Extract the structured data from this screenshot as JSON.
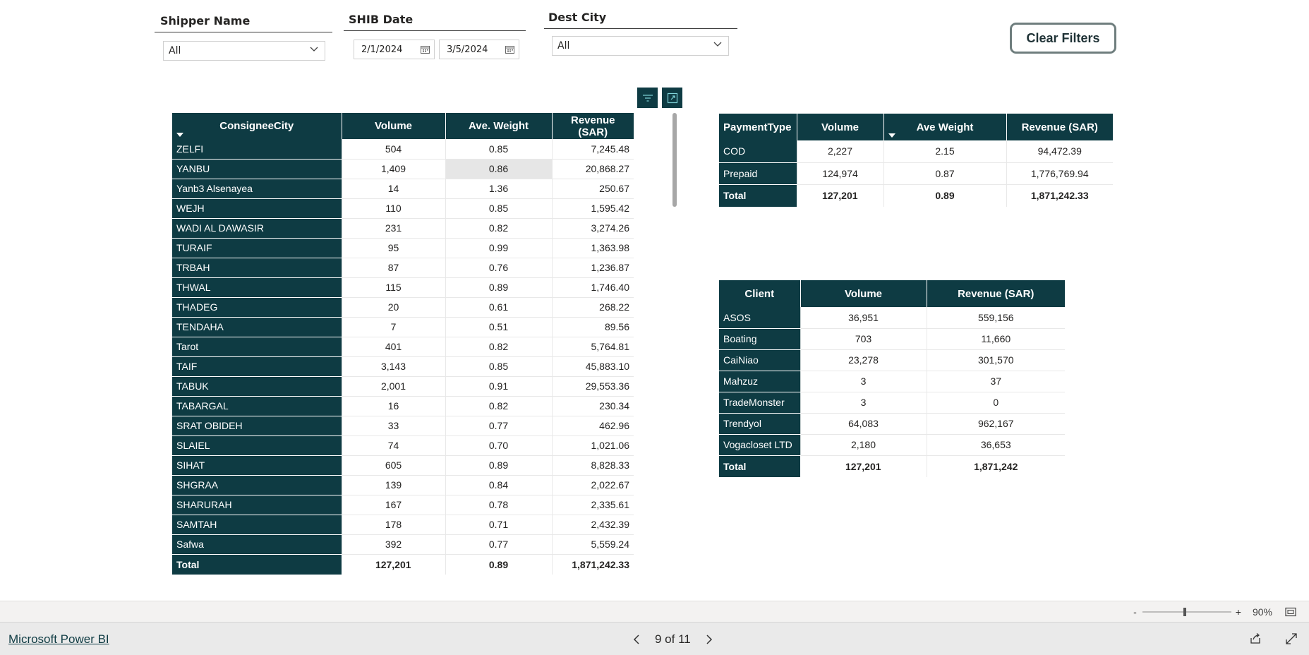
{
  "slicers": {
    "shipper": {
      "title": "Shipper Name",
      "value": "All"
    },
    "date": {
      "title": "SHIB Date",
      "start": "2/1/2024",
      "end": "3/5/2024"
    },
    "dest": {
      "title": "Dest City",
      "value": "All"
    }
  },
  "clear_filters_label": "Clear Filters",
  "visual_buttons": {
    "filter_icon": "filter-icon",
    "focus_icon": "focus-mode-icon"
  },
  "city_table": {
    "headers": [
      "ConsigneeCity",
      "Volume",
      "Ave. Weight",
      "Revenue (SAR)"
    ],
    "rows": [
      [
        "ZELFI",
        "504",
        "0.85",
        "7,245.48"
      ],
      [
        "YANBU",
        "1,409",
        "0.86",
        "20,868.27"
      ],
      [
        "Yanb3 Alsenayea",
        "14",
        "1.36",
        "250.67"
      ],
      [
        "WEJH",
        "110",
        "0.85",
        "1,595.42"
      ],
      [
        "WADI AL DAWASIR",
        "231",
        "0.82",
        "3,274.26"
      ],
      [
        "TURAIF",
        "95",
        "0.99",
        "1,363.98"
      ],
      [
        "TRBAH",
        "87",
        "0.76",
        "1,236.87"
      ],
      [
        "THWAL",
        "115",
        "0.89",
        "1,746.40"
      ],
      [
        "THADEG",
        "20",
        "0.61",
        "268.22"
      ],
      [
        "TENDAHA",
        "7",
        "0.51",
        "89.56"
      ],
      [
        "Tarot",
        "401",
        "0.82",
        "5,764.81"
      ],
      [
        "TAIF",
        "3,143",
        "0.85",
        "45,883.10"
      ],
      [
        "TABUK",
        "2,001",
        "0.91",
        "29,553.36"
      ],
      [
        "TABARGAL",
        "16",
        "0.82",
        "230.34"
      ],
      [
        "SRAT OBIDEH",
        "33",
        "0.77",
        "462.96"
      ],
      [
        "SLAIEL",
        "74",
        "0.70",
        "1,021.06"
      ],
      [
        "SIHAT",
        "605",
        "0.89",
        "8,828.33"
      ],
      [
        "SHGRAA",
        "139",
        "0.84",
        "2,022.67"
      ],
      [
        "SHARURAH",
        "167",
        "0.78",
        "2,335.61"
      ],
      [
        "SAMTAH",
        "178",
        "0.71",
        "2,432.39"
      ],
      [
        "Safwa",
        "392",
        "0.77",
        "5,559.24"
      ]
    ],
    "total": [
      "Total",
      "127,201",
      "0.89",
      "1,871,242.33"
    ]
  },
  "payment_table": {
    "headers": [
      "PaymentType",
      "Volume",
      "Ave Weight",
      "Revenue (SAR)"
    ],
    "rows": [
      [
        "COD",
        "2,227",
        "2.15",
        "94,472.39"
      ],
      [
        "Prepaid",
        "124,974",
        "0.87",
        "1,776,769.94"
      ]
    ],
    "total": [
      "Total",
      "127,201",
      "0.89",
      "1,871,242.33"
    ]
  },
  "client_table": {
    "headers": [
      "Client",
      "Volume",
      "Revenue (SAR)"
    ],
    "rows": [
      [
        "ASOS",
        "36,951",
        "559,156"
      ],
      [
        "Boating",
        "703",
        "11,660"
      ],
      [
        "CaiNiao",
        "23,278",
        "301,570"
      ],
      [
        "Mahzuz",
        "3",
        "37"
      ],
      [
        "TradeMonster",
        "3",
        "0"
      ],
      [
        "Trendyol",
        "64,083",
        "962,167"
      ],
      [
        "Vogacloset LTD",
        "2,180",
        "36,653"
      ]
    ],
    "total": [
      "Total",
      "127,201",
      "1,871,242"
    ]
  },
  "zoom": {
    "minus": "-",
    "plus": "+",
    "level": "90%"
  },
  "footer": {
    "brand": "Microsoft Power BI",
    "page": "9 of 11"
  },
  "colors": {
    "header_bg": "#0e3b43",
    "header_text": "#ffffff"
  }
}
